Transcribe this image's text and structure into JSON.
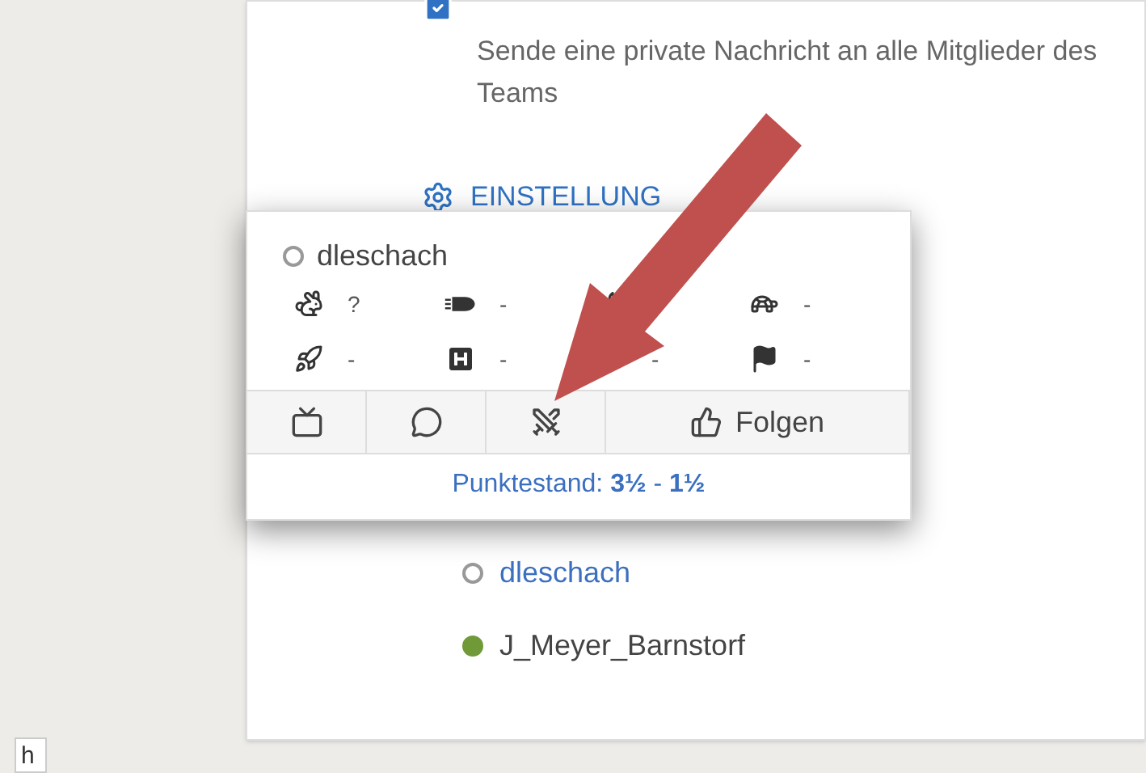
{
  "panel": {
    "message_description": "Sende eine private Nachricht an alle Mitglieder des Teams",
    "settings_link": "EINSTELLUNG"
  },
  "popup": {
    "player": {
      "name": "dleschach",
      "online": false
    },
    "stats": [
      {
        "kind": "rabbit",
        "value": "?"
      },
      {
        "kind": "bullet",
        "value": "-"
      },
      {
        "kind": "fire"
      },
      {
        "kind": "turtle",
        "value": "-"
      },
      {
        "kind": "rocket",
        "value": "-"
      },
      {
        "kind": "hospital",
        "value": "-"
      },
      {
        "kind": "covered",
        "value": "-"
      },
      {
        "kind": "flag",
        "value": "-"
      }
    ],
    "actions": [
      {
        "kind": "tv"
      },
      {
        "kind": "chat"
      },
      {
        "kind": "swords"
      },
      {
        "kind": "follow",
        "label": "Folgen"
      }
    ],
    "score": "Punktestand: **3½** - **1½**"
  },
  "members": [
    {
      "name": "dleschach",
      "online": false,
      "link": true
    },
    {
      "name": "J_Meyer_Barnstorf",
      "online": true,
      "color": "#6f9a37",
      "link": false
    }
  ],
  "tab": {
    "label": "h"
  }
}
